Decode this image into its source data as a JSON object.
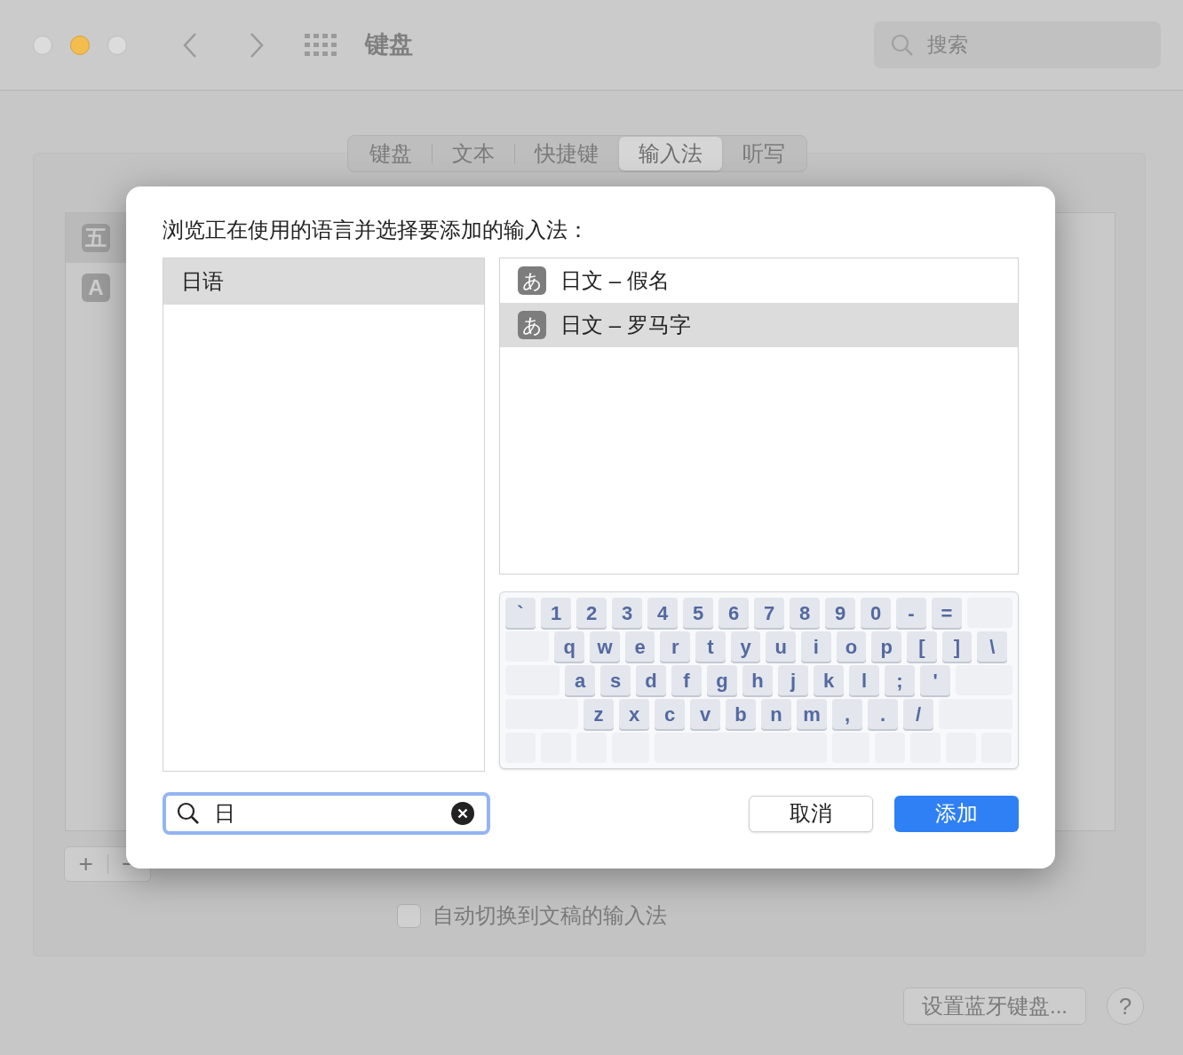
{
  "window": {
    "title": "键盘",
    "search": {
      "placeholder": "搜索"
    }
  },
  "tabs": [
    {
      "label": "键盘",
      "selected": false
    },
    {
      "label": "文本",
      "selected": false
    },
    {
      "label": "快捷键",
      "selected": false
    },
    {
      "label": "输入法",
      "selected": true
    },
    {
      "label": "听写",
      "selected": false
    }
  ],
  "input_sources": [
    {
      "icon": "五",
      "selected": true
    },
    {
      "icon": "A",
      "selected": false
    }
  ],
  "list_buttons": [
    "+",
    "−"
  ],
  "checkbox": {
    "label": "自动切换到文稿的输入法",
    "checked": false
  },
  "bluetooth_button": "设置蓝牙键盘...",
  "help_button": "?",
  "sheet": {
    "prompt": "浏览正在使用的语言并选择要添加的输入法：",
    "languages": [
      {
        "label": "日语",
        "selected": true
      }
    ],
    "input_methods": [
      {
        "icon": "あ",
        "label": "日文 – 假名",
        "selected": false
      },
      {
        "icon": "あ",
        "label": "日文 – 罗马字",
        "selected": true
      }
    ],
    "keyboard": {
      "rows": [
        [
          "`",
          "1",
          "2",
          "3",
          "4",
          "5",
          "6",
          "7",
          "8",
          "9",
          "0",
          "-",
          "="
        ],
        [
          "q",
          "w",
          "e",
          "r",
          "t",
          "y",
          "u",
          "i",
          "o",
          "p",
          "[",
          "]",
          "\\"
        ],
        [
          "a",
          "s",
          "d",
          "f",
          "g",
          "h",
          "j",
          "k",
          "l",
          ";",
          "'"
        ],
        [
          "z",
          "x",
          "c",
          "v",
          "b",
          "n",
          "m",
          ",",
          ".",
          "/"
        ]
      ]
    },
    "search": {
      "value": "日"
    },
    "buttons": [
      {
        "label": "取消",
        "kind": "secondary"
      },
      {
        "label": "添加",
        "kind": "primary"
      }
    ]
  }
}
